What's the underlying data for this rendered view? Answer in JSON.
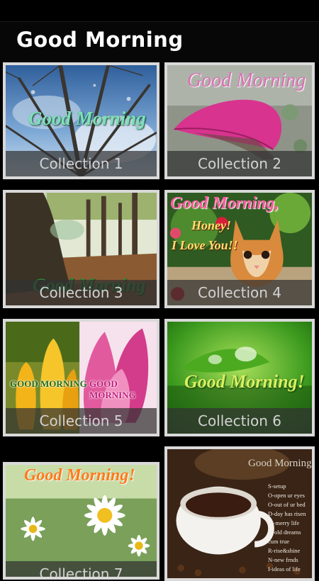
{
  "app": {
    "title": "Good Morning"
  },
  "collections": [
    {
      "label": "Collection 1",
      "overlay": "Good Morning"
    },
    {
      "label": "Collection 2",
      "overlay": "Good Morning"
    },
    {
      "label": "Collection 3",
      "overlay": "Good Morning"
    },
    {
      "label": "Collection 4",
      "overlay_line1": "Good Morning,",
      "overlay_line2": "Honey!",
      "overlay_line3": "I Love You!!"
    },
    {
      "label": "Collection 5",
      "overlay_left": "GOOD MORNING",
      "overlay_right": "GOOD MORNING"
    },
    {
      "label": "Collection 6",
      "overlay": "Good Morning!"
    },
    {
      "label": "Collection 7",
      "overlay": "Good Morning!"
    },
    {
      "overlay": "Good Morning",
      "poem": [
        "S-setup",
        "O-open ur eyes",
        "O-out of ur bed",
        "D-day has risen",
        "M-merry life",
        "O-old dreams cum true",
        "R-rise&shine",
        "N-new frnds",
        "I-ideas of life"
      ]
    }
  ]
}
